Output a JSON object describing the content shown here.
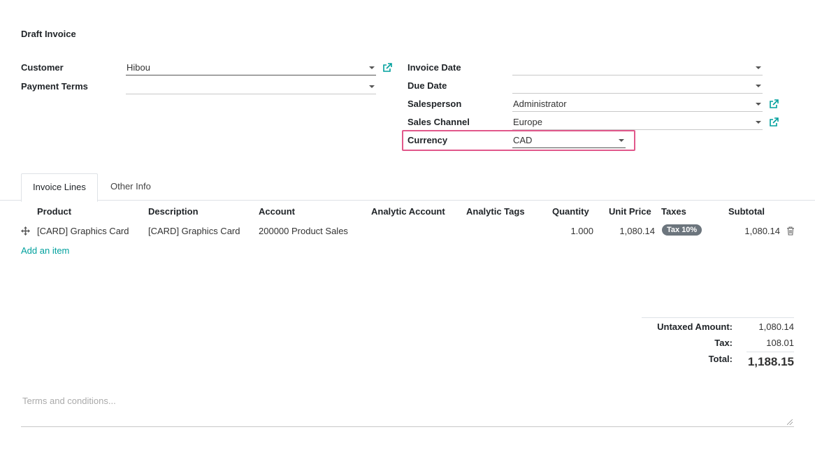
{
  "page": {
    "title": "Draft Invoice"
  },
  "left_fields": {
    "customer": {
      "label": "Customer",
      "value": "Hibou"
    },
    "payment_terms": {
      "label": "Payment Terms",
      "value": ""
    }
  },
  "right_fields": {
    "invoice_date": {
      "label": "Invoice Date",
      "value": ""
    },
    "due_date": {
      "label": "Due Date",
      "value": ""
    },
    "salesperson": {
      "label": "Salesperson",
      "value": "Administrator"
    },
    "sales_channel": {
      "label": "Sales Channel",
      "value": "Europe"
    },
    "currency": {
      "label": "Currency",
      "value": "CAD"
    }
  },
  "tabs": [
    {
      "label": "Invoice Lines",
      "active": true
    },
    {
      "label": "Other Info",
      "active": false
    }
  ],
  "table": {
    "headers": [
      "Product",
      "Description",
      "Account",
      "Analytic Account",
      "Analytic Tags",
      "Quantity",
      "Unit Price",
      "Taxes",
      "Subtotal"
    ],
    "rows": [
      {
        "product": "[CARD] Graphics Card",
        "description": "[CARD] Graphics Card",
        "account": "200000 Product Sales",
        "analytic_account": "",
        "analytic_tags": "",
        "quantity": "1.000",
        "unit_price": "1,080.14",
        "tax": "Tax 10%",
        "subtotal": "1,080.14"
      }
    ],
    "add_item": "Add an item"
  },
  "totals": {
    "untaxed_label": "Untaxed Amount:",
    "untaxed_value": "1,080.14",
    "tax_label": "Tax:",
    "tax_value": "108.01",
    "total_label": "Total:",
    "total_value": "1,188.15"
  },
  "terms": {
    "placeholder": "Terms and conditions..."
  },
  "colors": {
    "accent": "#00A09D",
    "highlight": "#e1588b",
    "badge": "#6c757d"
  }
}
